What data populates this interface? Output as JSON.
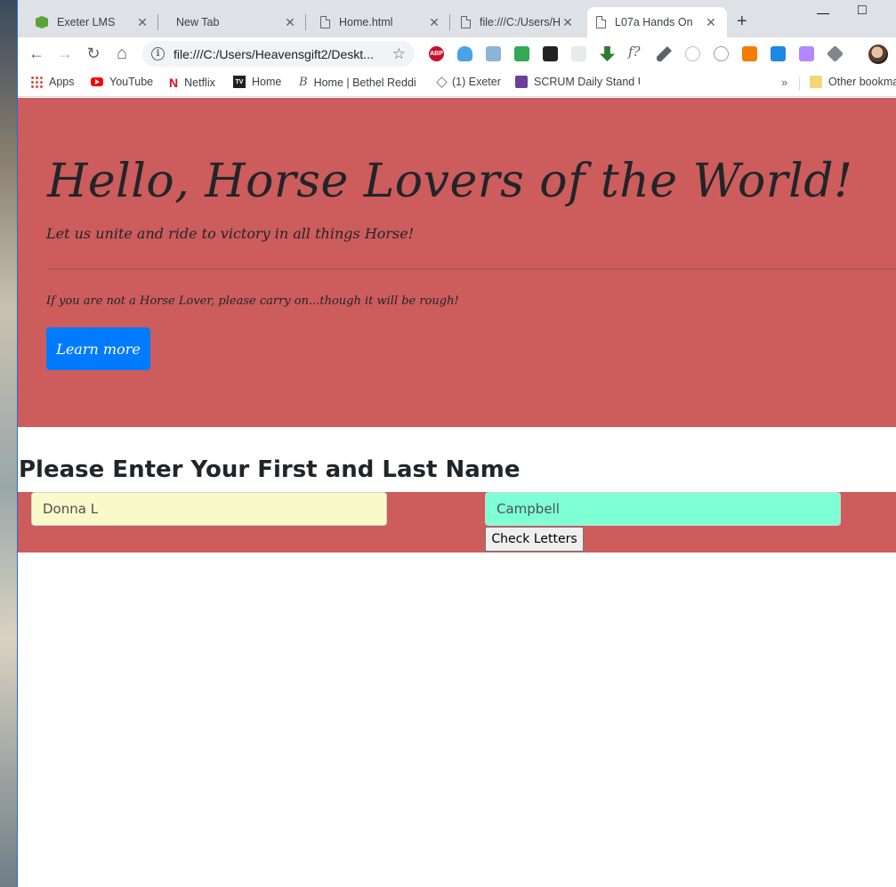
{
  "window": {
    "minimize_glyph": "—",
    "maximize_glyph": "□"
  },
  "tabs": [
    {
      "label": "Exeter LMS",
      "icon": "exeter-lms-icon",
      "active": false
    },
    {
      "label": "New Tab",
      "icon": "none",
      "active": false
    },
    {
      "label": "Home.html",
      "icon": "file-icon",
      "active": false
    },
    {
      "label": "file:///C:/Users/He",
      "icon": "file-icon",
      "active": false
    },
    {
      "label": "L07a Hands On",
      "icon": "file-icon",
      "active": true
    }
  ],
  "toolbar": {
    "url": "file:///C:/Users/Heavensgift2/Deskt...",
    "back": "←",
    "forward": "→",
    "reload": "↻",
    "home": "⌂",
    "star": "☆"
  },
  "bookmarks": [
    {
      "label": "Apps",
      "icon": "apps-grid-icon"
    },
    {
      "label": "YouTube",
      "icon": "youtube-icon"
    },
    {
      "label": "Netflix",
      "icon": "netflix-icon"
    },
    {
      "label": "Home",
      "icon": "tv-icon"
    },
    {
      "label": "Home | Bethel Reddi",
      "icon": "bethel-icon"
    },
    {
      "label": "(1) Exeter",
      "icon": "exeter-icon"
    },
    {
      "label": "SCRUM Daily Stand U",
      "icon": "scrum-icon"
    }
  ],
  "other_bookmarks": "Other bookmarks",
  "page": {
    "title": "Hello, Horse Lovers of the World!",
    "lead": "Let us unite and ride to victory in all things Horse!",
    "note": "If you are not a Horse Lover, please carry on...though it will be rough!",
    "learn_more": "Learn more",
    "form_heading": "Please Enter Your First and Last Name",
    "first_name_value": "Donna L",
    "last_name_value": "Campbell",
    "check_button": "Check Letters"
  },
  "colors": {
    "jumbotron": "#cd5c5c",
    "primary_button": "#007bff",
    "first_field": "#fafac8",
    "last_field": "#7fffd4"
  }
}
